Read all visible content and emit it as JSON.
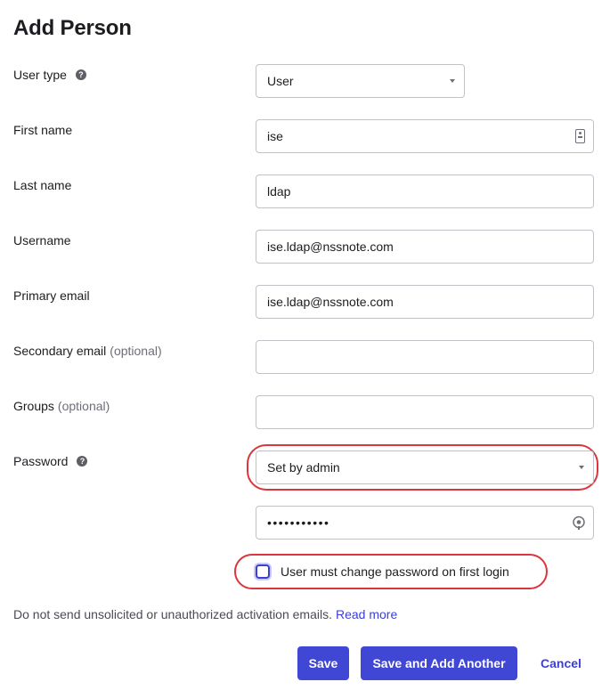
{
  "page": {
    "title": "Add Person"
  },
  "form": {
    "user_type": {
      "label": "User type",
      "value": "User"
    },
    "first_name": {
      "label": "First name",
      "value": "ise"
    },
    "last_name": {
      "label": "Last name",
      "value": "ldap"
    },
    "username": {
      "label": "Username",
      "value": "ise.ldap@nssnote.com"
    },
    "primary_email": {
      "label": "Primary email",
      "value": "ise.ldap@nssnote.com"
    },
    "secondary_email": {
      "label": "Secondary email",
      "optional": "(optional)",
      "value": ""
    },
    "groups": {
      "label": "Groups",
      "optional": "(optional)",
      "value": ""
    },
    "password": {
      "label": "Password",
      "mode": "Set by admin",
      "masked_value": "•••••••••••"
    },
    "change_password": {
      "label": "User must change password on first login",
      "checked": false
    }
  },
  "help_glyph": "?",
  "notice": {
    "text": "Do not send unsolicited or unauthorized activation emails.",
    "link": "Read more"
  },
  "actions": {
    "save": "Save",
    "save_add_another": "Save and Add Another",
    "cancel": "Cancel"
  },
  "colors": {
    "primary": "#4147d5",
    "highlight": "#d9363e",
    "text": "#1d1d21"
  },
  "icons": {
    "card": "contact-card-icon",
    "eye": "password-reveal-icon",
    "caret": "chevron-down-icon"
  }
}
